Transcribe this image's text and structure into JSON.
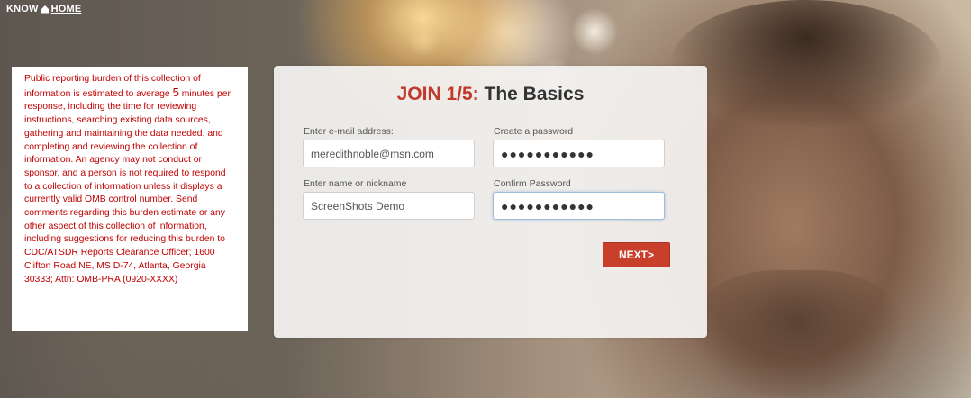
{
  "logo": {
    "part1": "KNOW",
    "part2": "HOME"
  },
  "disclaimer": {
    "text_before": "Public reporting burden of this collection of information is estimated to average ",
    "minutes": "5",
    "text_after": " minutes per response, including the time for reviewing instructions, searching existing data sources, gathering and maintaining the data needed, and completing and reviewing the collection of information.  An agency may not conduct or sponsor, and a person is not required to respond to a collection of information unless it displays a currently valid OMB control number.  Send comments regarding this burden estimate or any other aspect of this collection of information, including suggestions for reducing this burden to CDC/ATSDR Reports Clearance Officer; 1600 Clifton Road NE, MS D-74, Atlanta, Georgia 30333; Attn: OMB-PRA (0920-XXXX)"
  },
  "form": {
    "title_step": "JOIN 1/5:",
    "title_text": " The Basics",
    "email": {
      "label": "Enter e-mail address:",
      "value": "meredithnoble@msn.com"
    },
    "password": {
      "label": "Create a password",
      "value": "●●●●●●●●●●●"
    },
    "name": {
      "label": "Enter name or nickname",
      "value": "ScreenShots Demo"
    },
    "confirm_password": {
      "label": "Confirm Password",
      "value": "●●●●●●●●●●●"
    },
    "next_label": "NEXT>"
  },
  "colors": {
    "accent": "#c8402b",
    "disclaimer_text": "#c00000"
  }
}
